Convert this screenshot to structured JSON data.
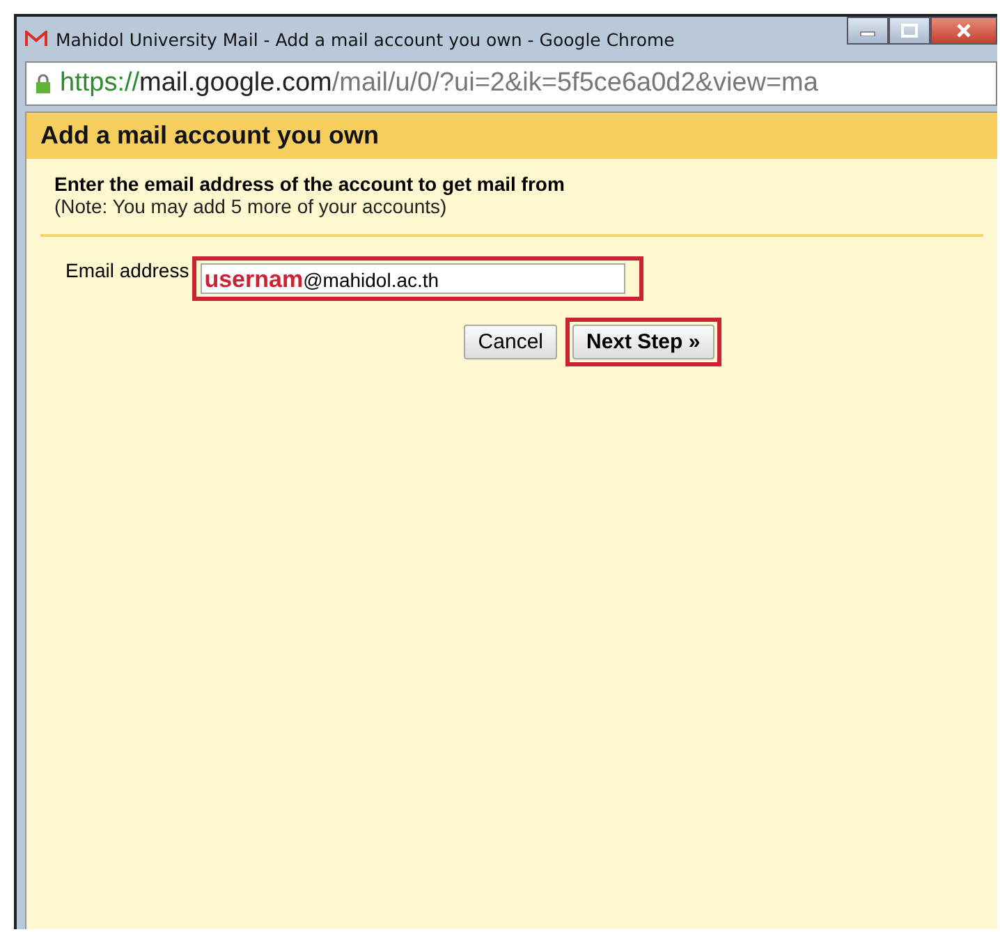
{
  "window": {
    "title": "Mahidol University Mail - Add a mail account you own - Google Chrome"
  },
  "address_bar": {
    "scheme": "https://",
    "host": "mail.google.com",
    "path": "/mail/u/0/?ui=2&ik=5f5ce6a0d2&view=ma"
  },
  "dialog": {
    "title": "Add a mail account you own",
    "instruction": "Enter the email address of the account to get mail from",
    "note": "(Note: You may add 5 more of your accounts)",
    "email_field": {
      "label": "Email address",
      "value": "**usernam**@mahidol.ac.th",
      "highlighted": true
    },
    "buttons": [
      {
        "label": "Cancel",
        "kind": "secondary",
        "highlighted": false
      },
      {
        "label": "Next Step »",
        "kind": "primary",
        "highlighted": true
      }
    ]
  }
}
